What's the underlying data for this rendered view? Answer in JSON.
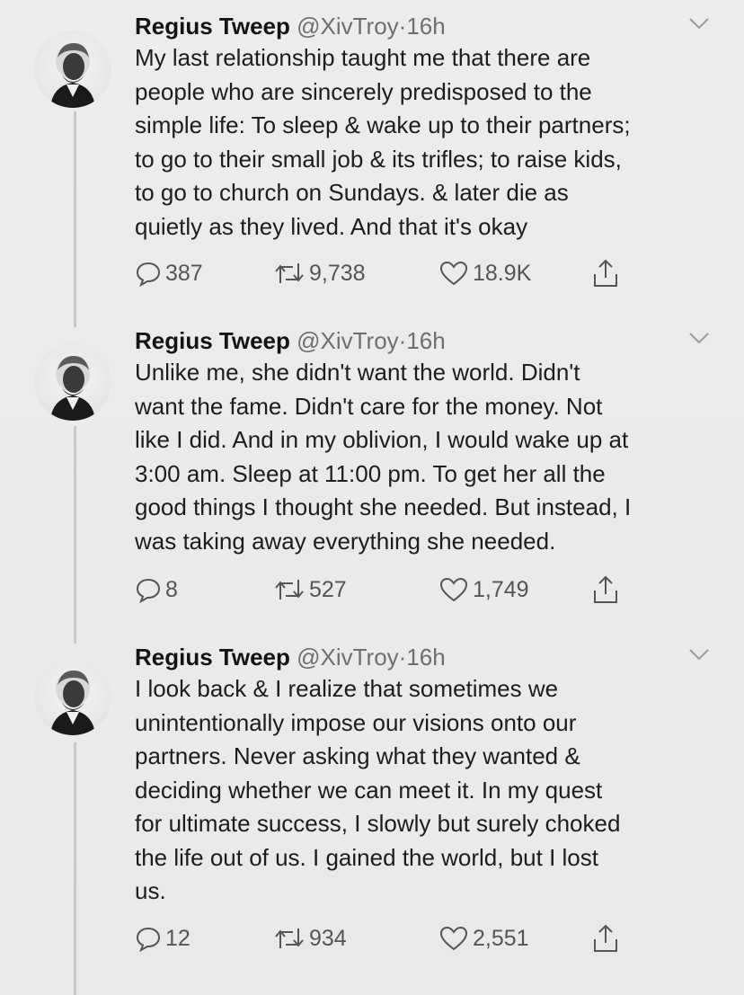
{
  "tweets": [
    {
      "name": "Regius Tweep",
      "handle": "@XivTroy",
      "time": "16h",
      "text": "My last relationship taught me that there are\npeople who are sincerely predisposed to the\nsimple life: To sleep & wake up to their partners;\nto go to their small job & its trifles; to raise kids,\nto go to church on Sundays. & later die as\nquietly as they lived. And that it's okay",
      "replies": "387",
      "retweets": "9,738",
      "likes": "18.9K"
    },
    {
      "name": "Regius Tweep",
      "handle": "@XivTroy",
      "time": "16h",
      "text": "Unlike me, she didn't want the world. Didn't\nwant the fame. Didn't care for the money. Not\nlike I did. And in my oblivion, I would wake up at\n3:00 am. Sleep at 11:00 pm. To get her all the\ngood things I thought she needed. But instead, I\nwas taking away everything she needed.",
      "replies": "8",
      "retweets": "527",
      "likes": "1,749"
    },
    {
      "name": "Regius Tweep",
      "handle": "@XivTroy",
      "time": "16h",
      "text": "I look back & I realize that sometimes we\nunintentionally impose our visions onto our\npartners. Never asking what they wanted &\ndeciding whether we can meet it. In my quest\nfor ultimate success, I slowly but surely choked\nthe life out of us. I gained the world, but I lost\nus.",
      "replies": "12",
      "retweets": "934",
      "likes": "2,551"
    }
  ],
  "separator": "·",
  "icons": {
    "reply": "reply-icon",
    "retweet": "retweet-icon",
    "like": "heart-icon",
    "share": "share-icon",
    "menu": "chevron-down-icon"
  },
  "colors": {
    "background": "#ececec",
    "text": "#1b1b1b",
    "meta": "#6f6f6f",
    "icon": "#555555",
    "thread_line": "#c8c8c8"
  }
}
